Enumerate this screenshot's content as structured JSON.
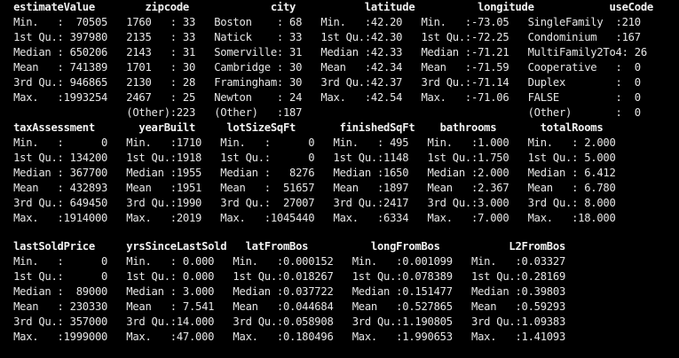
{
  "terminal": {
    "background": "#000000",
    "foreground": "#e6e6e6",
    "lines": [
      " estimateValue        zipcode             city           latitude          longitude            useCode   ",
      " Min.   :  70505   1760   : 33   Boston    : 68   Min.   :42.20   Min.   :-73.05   SingleFamily  :210  ",
      " 1st Qu.: 397980   2135   : 33   Natick    : 33   1st Qu.:42.30   1st Qu.:-72.25   Condominium   :167  ",
      " Median : 650206   2143   : 31   Somerville: 31   Median :42.33   Median :-71.21   MultiFamily2To4: 26  ",
      " Mean   : 741389   1701   : 30   Cambridge : 30   Mean   :42.34   Mean   :-71.59   Cooperative   :  0  ",
      " 3rd Qu.: 946865   2130   : 28   Framingham: 30   3rd Qu.:42.37   3rd Qu.:-71.14   Duplex        :  0  ",
      " Max.   :1993254   2467   : 25   Newton    : 24   Max.   :42.54   Max.   :-71.06   FALSE         :  0  ",
      "                   (Other):223   (Other)   :187                                    (Other)       :  0  ",
      " taxAssessment       yearBuilt     lotSizeSqFt       finishedSqFt    bathrooms       totalRooms    ",
      " Min.   :      0   Min.   :1710   Min.   :      0   Min.   : 495   Min.   :1.000   Min.   : 2.000  ",
      " 1st Qu.: 134200   1st Qu.:1918   1st Qu.:      0   1st Qu.:1148   1st Qu.:1.750   1st Qu.: 5.000  ",
      " Median : 367700   Median :1955   Median :   8276   Median :1650   Median :2.000   Median : 6.412  ",
      " Mean   : 432893   Mean   :1951   Mean   :  51657   Mean   :1897   Mean   :2.367   Mean   : 6.780  ",
      " 3rd Qu.: 649450   3rd Qu.:1990   3rd Qu.:  27007   3rd Qu.:2417   3rd Qu.:3.000   3rd Qu.: 8.000  ",
      " Max.   :1914000   Max.   :2019   Max.   :1045440   Max.   :6334   Max.   :7.000   Max.   :18.000  ",
      "",
      " lastSoldPrice     yrsSinceLastSold   latFromBos          longFromBos           L2FromBos       ",
      " Min.   :      0   Min.   : 0.000   Min.   :0.000152   Min.   :0.001099   Min.   :0.03327  ",
      " 1st Qu.:      0   1st Qu.: 0.000   1st Qu.:0.018267   1st Qu.:0.078389   1st Qu.:0.28169  ",
      " Median :  89000   Median : 3.000   Median :0.037722   Median :0.151477   Median :0.39803  ",
      " Mean   : 230330   Mean   : 7.541   Mean   :0.044684   Mean   :0.527865   Mean   :0.59293  ",
      " 3rd Qu.: 357000   3rd Qu.:14.000   3rd Qu.:0.058908   3rd Qu.:1.190805   3rd Qu.:1.09383  ",
      " Max.   :1999000   Max.   :47.000   Max.   :0.180496   Max.   :1.990653   Max.   :1.41093  "
    ]
  }
}
